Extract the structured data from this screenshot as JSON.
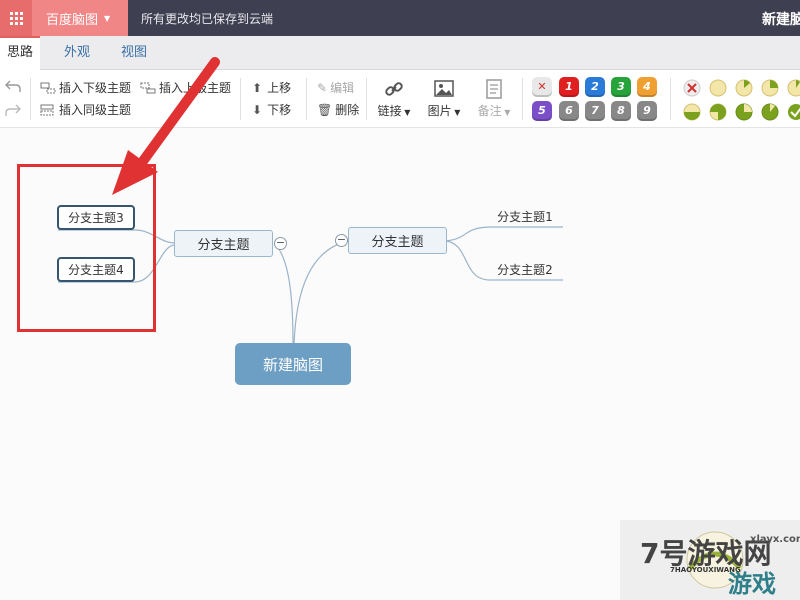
{
  "header": {
    "app_name": "百度脑图",
    "save_status": "所有更改均已保存到云端",
    "doc_title": "新建脑图"
  },
  "tabs": [
    {
      "label": "思路",
      "active": true
    },
    {
      "label": "外观",
      "active": false
    },
    {
      "label": "视图",
      "active": false
    }
  ],
  "toolbar": {
    "insert_child": "插入下级主题",
    "insert_parent": "插入上级主题",
    "insert_sibling": "插入同级主题",
    "move_up": "上移",
    "move_down": "下移",
    "edit": "编辑",
    "delete": "删除",
    "link": "链接",
    "image": "图片",
    "note": "备注",
    "priority": [
      "1",
      "2",
      "3",
      "4",
      "5",
      "6",
      "7",
      "8",
      "9"
    ],
    "priority_colors": [
      "#e02020",
      "#2a7ad8",
      "#27a33b",
      "#f0a030",
      "#7a4fc8",
      "#888888",
      "#888888",
      "#888888",
      "#888888"
    ]
  },
  "mindmap": {
    "root": "新建脑图",
    "left_branch": "分支主题",
    "right_branch": "分支主题",
    "left_children": [
      "分支主题3",
      "分支主题4"
    ],
    "right_children": [
      "分支主题1",
      "分支主题2"
    ]
  },
  "watermark": {
    "text1": "7号游戏网",
    "text2": "游戏",
    "url": "xlayx.com",
    "sub": "7HAOYOUXIWANG"
  },
  "colors": {
    "accent": "#e06060",
    "topbar": "#3f3f52",
    "root_node": "#6d9ec3",
    "highlight_box": "#e03232"
  }
}
